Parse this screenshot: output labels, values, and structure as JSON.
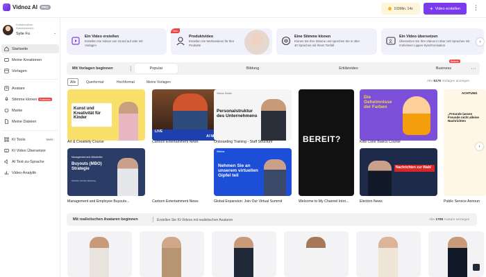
{
  "app": {
    "name": "Vidnoz AI",
    "plan_badge": "PRO"
  },
  "topbar": {
    "credits": "103Min. 14s",
    "create_button": "Video erstellen"
  },
  "workspace": {
    "label": "Kollaborativer Arbeitsbereich",
    "user": "Sylie Fu"
  },
  "sidebar": {
    "items": [
      {
        "label": "Startseite",
        "icon": "home-icon",
        "active": true
      },
      {
        "label": "Meine Kreationen",
        "icon": "folder-icon"
      },
      {
        "label": "Vorlagen",
        "icon": "template-icon"
      },
      {
        "label": "Avatare",
        "icon": "avatar-icon"
      },
      {
        "label": "Stimme klonen",
        "icon": "voice-icon",
        "badge": "Kostenlos"
      },
      {
        "label": "Marke",
        "icon": "brand-icon"
      },
      {
        "label": "Meine Dateien",
        "icon": "files-icon"
      },
      {
        "label": "KI Tools",
        "icon": "tools-icon",
        "more": "Mehr"
      },
      {
        "label": "KI Video Übersetzer",
        "icon": "translate-icon"
      },
      {
        "label": "AI Text-zu-Sprache",
        "icon": "tts-icon"
      },
      {
        "label": "Video-Analytik",
        "icon": "analytics-icon"
      }
    ]
  },
  "quick_cards": [
    {
      "title": "Ein Video erstellen",
      "desc": "Erstellen Sie Videos von Grund auf oder mit Vorlagen"
    },
    {
      "title": "Produktvideo",
      "desc": "Erstellen Sie Werbevideos für Ihre Produkte",
      "badge": "Neu"
    },
    {
      "title": "Eine Stimme klonen",
      "desc": "Klonen Sie Ihre Stimme und sprechen Sie in über 40 Sprachen mit Ihrem Tonfall"
    },
    {
      "title": "Ein Video übersetzen",
      "desc": "Übersetzen Sie Ihre Videos in über 140 Sprachen mit müheloser Lippen-Synchronisation"
    }
  ],
  "templates_section": {
    "title": "Mit Vorlagen beginnen",
    "tabs": [
      "Popular",
      "Bildung",
      "Erklärvideo",
      "Business"
    ],
    "business_badge": "Beliebt",
    "filters": [
      "Alle",
      "Querformat",
      "Hochformat",
      "Meine Vorlagen"
    ],
    "count_prefix": "Alle",
    "count": "5175",
    "count_suffix": "Vorlagen anzeigen"
  },
  "templates": [
    {
      "label": "Art & Creativity Course",
      "text": "Kunst und Kreativität für Kinder"
    },
    {
      "label": "Cartoon Entertainment News",
      "text_top": "LIVE",
      "text_bottom": "AI NEWS"
    },
    {
      "label": "Onboarding Training - Staff Structure",
      "text": "Personalstruktur des Unternehmens",
      "brand": "Vidnoz Studio"
    },
    {
      "label": "Welcome to My Channel Intro...",
      "text": "BEREIT?"
    },
    {
      "label": "Kids Color Basics Course",
      "text": "Die Geheimnisse der Farben"
    },
    {
      "label": "ACHTUNG",
      "text": "„Freunde lassen Freunde nicht alleine Nachrichten"
    },
    {
      "label": "Management and Employee Buyouts...",
      "small": "Management and Mitarbeiter",
      "text": "Buyouts (MBO) Strategie",
      "foot": "Nächste Schritte Beratung"
    },
    {
      "label": "Global Expansion: Join Our Virtual Summit",
      "text": "Nehmen Sie an unserem virtuellen Gipfel teil",
      "brand": "Vidnoz"
    },
    {
      "label": "Election News",
      "text": "Nachrichten zur Wahl"
    },
    {
      "label": "Public Service Announ"
    }
  ],
  "avatars_section": {
    "title": "Mit realistischen Avataren beginnen",
    "subtitle": "Erstellen Sie KI-Videos mit realistischen Avataren",
    "count_prefix": "Alle",
    "count": "1708",
    "count_suffix": "Avatare anzeigen"
  }
}
